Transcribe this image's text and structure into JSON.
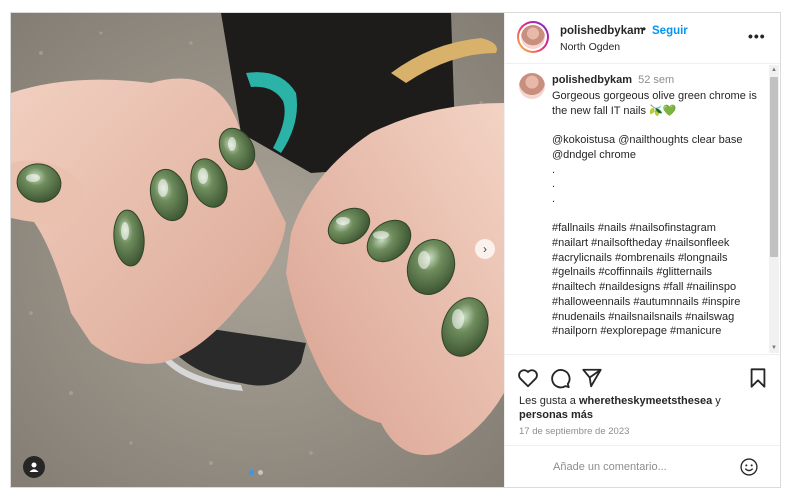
{
  "post": {
    "username": "polishedbykam",
    "follow_label": "Seguir",
    "separator": "•",
    "location": "North Ogden",
    "more_label": "•••"
  },
  "caption": {
    "username": "polishedbykam",
    "time": "52 sem",
    "lines": [
      "Gorgeous gorgeous olive green chrome is the new fall IT nails 🫒💚",
      "",
      "@kokoistusa @nailthoughts clear base",
      "@dndgel chrome",
      ".",
      ".",
      ".",
      "",
      "#fallnails #nails #nailsofinstagram",
      "#nailart #nailsoftheday #nailsonfleek",
      "#acrylicnails #ombrenails #longnails",
      "#gelnails #coffinnails #glitternails",
      "#nailtech #naildesigns #fall #nailinspo",
      "#halloweennails #autumnnails #inspire",
      "#nudenails #nailsnailsnails #nailswag",
      "#nailporn #explorepage #manicure"
    ]
  },
  "likes": {
    "prefix": "Les gusta a",
    "user": "wheretheskymeetsthesea",
    "suffix": "y",
    "others": "personas más"
  },
  "date": "17 de septiembre de 2023",
  "comment_input": {
    "placeholder": "Añade un comentario..."
  },
  "carousel": {
    "slide_count": 2,
    "active_slide": 1
  },
  "icons": {
    "like": "heart-icon",
    "comment": "comment-icon",
    "share": "share-icon",
    "save": "bookmark-icon",
    "emoji": "emoji-icon",
    "tag": "user-tag-icon",
    "next": "chevron-right-icon"
  },
  "colors": {
    "accent": "#0095f6",
    "nail": "#4f6b3f",
    "text": "#262626",
    "muted": "#8e8e8e"
  }
}
